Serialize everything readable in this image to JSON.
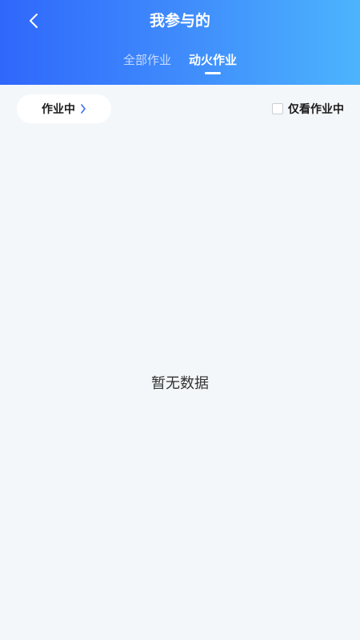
{
  "header": {
    "title": "我参与的",
    "back_icon": "chevron-left-icon",
    "tabs": [
      {
        "label": "全部作业",
        "active": false
      },
      {
        "label": "动火作业",
        "active": true
      }
    ],
    "gradient": [
      "#2f67fb",
      "#4cb4fd"
    ]
  },
  "filter": {
    "status_label": "作业中",
    "status_icon": "chevron-right-icon",
    "chevron_color": "#3b6cf6",
    "only_working_label": "仅看作业中",
    "only_working_checked": false
  },
  "empty": {
    "message": "暂无数据"
  }
}
